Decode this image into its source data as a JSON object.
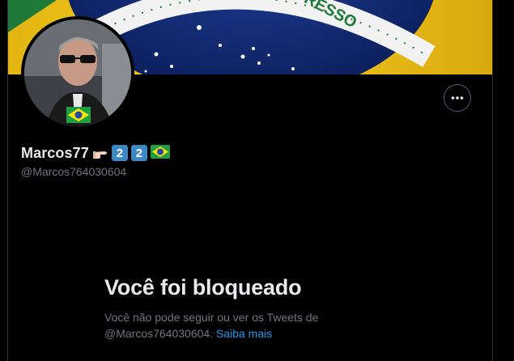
{
  "banner": {
    "flag_text": "GRESSO"
  },
  "profile": {
    "display_name": "Marcos77",
    "emojis": [
      "pointing-finger",
      "keycap-2",
      "keycap-2",
      "brazil-flag"
    ],
    "keycap_digit": "2",
    "handle": "@Marcos764030604"
  },
  "actions": {
    "more_icon": "more-horizontal-icon"
  },
  "blocked": {
    "title": "Você foi bloqueado",
    "message_prefix": "Você não pode seguir ou ver os Tweets de",
    "message_handle": "@Marcos764030604.",
    "learn_more": "Saiba mais"
  },
  "colors": {
    "background": "#000000",
    "text_primary": "#e7e9ea",
    "text_secondary": "#71767b",
    "link": "#1d9bf0",
    "keycap": "#3b88c3"
  }
}
